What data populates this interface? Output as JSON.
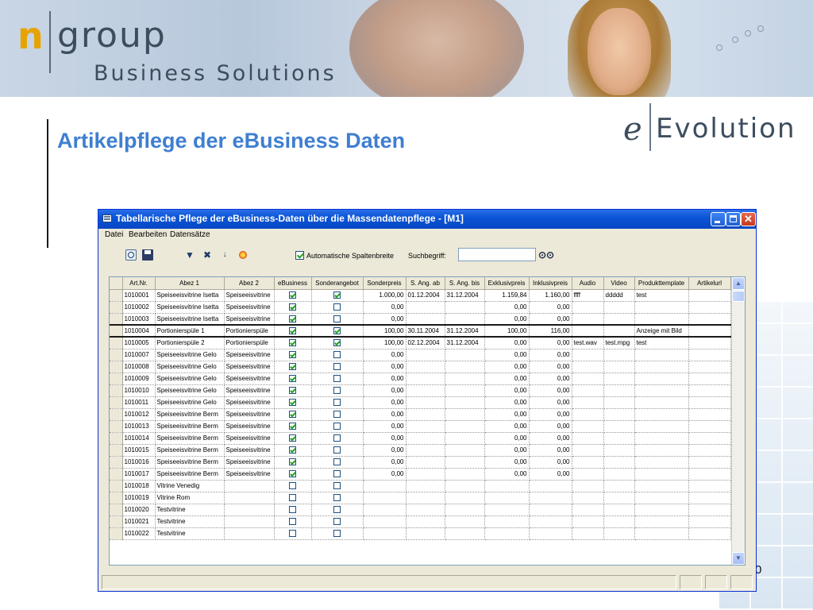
{
  "banner": {
    "logo_n": "n",
    "logo_group": "group",
    "logo_subtitle": "Business Solutions"
  },
  "slide": {
    "title": "Artikelpflege der eBusiness Daten",
    "evo_logo_e": "e",
    "evo_logo_word": "Evolution",
    "page_number": "0"
  },
  "window": {
    "title": "Tabellarische Pflege der eBusiness-Daten über die Massendatenpflege - [M1]",
    "menu": [
      "Datei",
      "Bearbeiten",
      "Datensätze"
    ],
    "toolbar": {
      "auto_width_label": "Automatische Spaltenbreite",
      "auto_width_checked": true,
      "search_label": "Suchbegriff:",
      "search_value": "",
      "icons": [
        "preview-icon",
        "save-icon",
        "filter-icon",
        "remove-filter-icon",
        "sort-icon",
        "color-icon",
        "binoculars-icon"
      ]
    },
    "columns": [
      "Art.Nr.",
      "Abez 1",
      "Abez 2",
      "eBusiness",
      "Sonderangebot",
      "Sonderpreis",
      "S. Ang. ab",
      "S. Ang. bis",
      "Exklusivpreis",
      "Inklusivpreis",
      "Audio",
      "Video",
      "Produkttemplate",
      "Artikelurl"
    ],
    "rows": [
      {
        "artnr": "1010001",
        "abez1": "Speiseeisvitrine Isetta",
        "abez2": "Speiseeisvitrine",
        "ebusiness": true,
        "sonder": true,
        "sonderpreis": "1.000,00",
        "ab": "01.12.2004",
        "bis": "31.12.2004",
        "exkl": "1.159,84",
        "inkl": "1.160,00",
        "audio": "ffff",
        "video": "ddddd",
        "template": "test",
        "url": ""
      },
      {
        "artnr": "1010002",
        "abez1": "Speiseeisvitrine Isetta",
        "abez2": "Speiseeisvitrine",
        "ebusiness": true,
        "sonder": false,
        "sonderpreis": "0,00",
        "ab": "",
        "bis": "",
        "exkl": "0,00",
        "inkl": "0,00",
        "audio": "",
        "video": "",
        "template": "",
        "url": ""
      },
      {
        "artnr": "1010003",
        "abez1": "Speiseeisvitrine Isetta",
        "abez2": "Speiseeisvitrine",
        "ebusiness": true,
        "sonder": false,
        "sonderpreis": "0,00",
        "ab": "",
        "bis": "",
        "exkl": "0,00",
        "inkl": "0,00",
        "audio": "",
        "video": "",
        "template": "",
        "url": ""
      },
      {
        "artnr": "1010004",
        "abez1": "Portionierspüle 1",
        "abez2": "Portionierspüle",
        "ebusiness": true,
        "sonder": true,
        "sonderpreis": "100,00",
        "ab": "30.11.2004",
        "bis": "31.12.2004",
        "exkl": "100,00",
        "inkl": "116,00",
        "audio": "",
        "video": "",
        "template": "Anzeige mit Bild",
        "url": "",
        "current": true
      },
      {
        "artnr": "1010005",
        "abez1": "Portionierspüle 2",
        "abez2": "Portionierspüle",
        "ebusiness": true,
        "sonder": true,
        "sonderpreis": "100,00",
        "ab": "02.12.2004",
        "bis": "31.12.2004",
        "exkl": "0,00",
        "inkl": "0,00",
        "audio": "test.wav",
        "video": "test.mpg",
        "template": "test",
        "url": ""
      },
      {
        "artnr": "1010007",
        "abez1": "Speiseeisvitrine Gelo",
        "abez2": "Speiseeisvitrine",
        "ebusiness": true,
        "sonder": false,
        "sonderpreis": "0,00",
        "ab": "",
        "bis": "",
        "exkl": "0,00",
        "inkl": "0,00",
        "audio": "",
        "video": "",
        "template": "",
        "url": ""
      },
      {
        "artnr": "1010008",
        "abez1": "Speiseeisvitrine Gelo",
        "abez2": "Speiseeisvitrine",
        "ebusiness": true,
        "sonder": false,
        "sonderpreis": "0,00",
        "ab": "",
        "bis": "",
        "exkl": "0,00",
        "inkl": "0,00",
        "audio": "",
        "video": "",
        "template": "",
        "url": ""
      },
      {
        "artnr": "1010009",
        "abez1": "Speiseeisvitrine Gelo",
        "abez2": "Speiseeisvitrine",
        "ebusiness": true,
        "sonder": false,
        "sonderpreis": "0,00",
        "ab": "",
        "bis": "",
        "exkl": "0,00",
        "inkl": "0,00",
        "audio": "",
        "video": "",
        "template": "",
        "url": ""
      },
      {
        "artnr": "1010010",
        "abez1": "Speiseeisvitrine Gelo",
        "abez2": "Speiseeisvitrine",
        "ebusiness": true,
        "sonder": false,
        "sonderpreis": "0,00",
        "ab": "",
        "bis": "",
        "exkl": "0,00",
        "inkl": "0,00",
        "audio": "",
        "video": "",
        "template": "",
        "url": ""
      },
      {
        "artnr": "1010011",
        "abez1": "Speiseeisvitrine Gelo",
        "abez2": "Speiseeisvitrine",
        "ebusiness": true,
        "sonder": false,
        "sonderpreis": "0,00",
        "ab": "",
        "bis": "",
        "exkl": "0,00",
        "inkl": "0,00",
        "audio": "",
        "video": "",
        "template": "",
        "url": ""
      },
      {
        "artnr": "1010012",
        "abez1": "Speiseeisvitrine Berm",
        "abez2": "Speiseeisvitrine",
        "ebusiness": true,
        "sonder": false,
        "sonderpreis": "0,00",
        "ab": "",
        "bis": "",
        "exkl": "0,00",
        "inkl": "0,00",
        "audio": "",
        "video": "",
        "template": "",
        "url": ""
      },
      {
        "artnr": "1010013",
        "abez1": "Speiseeisvitrine Berm",
        "abez2": "Speiseeisvitrine",
        "ebusiness": true,
        "sonder": false,
        "sonderpreis": "0,00",
        "ab": "",
        "bis": "",
        "exkl": "0,00",
        "inkl": "0,00",
        "audio": "",
        "video": "",
        "template": "",
        "url": ""
      },
      {
        "artnr": "1010014",
        "abez1": "Speiseeisvitrine Berm",
        "abez2": "Speiseeisvitrine",
        "ebusiness": true,
        "sonder": false,
        "sonderpreis": "0,00",
        "ab": "",
        "bis": "",
        "exkl": "0,00",
        "inkl": "0,00",
        "audio": "",
        "video": "",
        "template": "",
        "url": ""
      },
      {
        "artnr": "1010015",
        "abez1": "Speiseeisvitrine Berm",
        "abez2": "Speiseeisvitrine",
        "ebusiness": true,
        "sonder": false,
        "sonderpreis": "0,00",
        "ab": "",
        "bis": "",
        "exkl": "0,00",
        "inkl": "0,00",
        "audio": "",
        "video": "",
        "template": "",
        "url": ""
      },
      {
        "artnr": "1010016",
        "abez1": "Speiseeisvitrine Berm",
        "abez2": "Speiseeisvitrine",
        "ebusiness": true,
        "sonder": false,
        "sonderpreis": "0,00",
        "ab": "",
        "bis": "",
        "exkl": "0,00",
        "inkl": "0,00",
        "audio": "",
        "video": "",
        "template": "",
        "url": ""
      },
      {
        "artnr": "1010017",
        "abez1": "Speiseeisvitrine Berm",
        "abez2": "Speiseeisvitrine",
        "ebusiness": true,
        "sonder": false,
        "sonderpreis": "0,00",
        "ab": "",
        "bis": "",
        "exkl": "0,00",
        "inkl": "0,00",
        "audio": "",
        "video": "",
        "template": "",
        "url": ""
      },
      {
        "artnr": "1010018",
        "abez1": "Vitrine Venedig",
        "abez2": "",
        "ebusiness": false,
        "sonder": false,
        "sonderpreis": "",
        "ab": "",
        "bis": "",
        "exkl": "",
        "inkl": "",
        "audio": "",
        "video": "",
        "template": "",
        "url": ""
      },
      {
        "artnr": "1010019",
        "abez1": "Vitrine Rom",
        "abez2": "",
        "ebusiness": false,
        "sonder": false,
        "sonderpreis": "",
        "ab": "",
        "bis": "",
        "exkl": "",
        "inkl": "",
        "audio": "",
        "video": "",
        "template": "",
        "url": ""
      },
      {
        "artnr": "1010020",
        "abez1": "Testvitrine",
        "abez2": "",
        "ebusiness": false,
        "sonder": false,
        "sonderpreis": "",
        "ab": "",
        "bis": "",
        "exkl": "",
        "inkl": "",
        "audio": "",
        "video": "",
        "template": "",
        "url": ""
      },
      {
        "artnr": "1010021",
        "abez1": "Testvitrine",
        "abez2": "",
        "ebusiness": false,
        "sonder": false,
        "sonderpreis": "",
        "ab": "",
        "bis": "",
        "exkl": "",
        "inkl": "",
        "audio": "",
        "video": "",
        "template": "",
        "url": ""
      },
      {
        "artnr": "1010022",
        "abez1": "Testvitrine",
        "abez2": "",
        "ebusiness": false,
        "sonder": false,
        "sonderpreis": "",
        "ab": "",
        "bis": "",
        "exkl": "",
        "inkl": "",
        "audio": "",
        "video": "",
        "template": "",
        "url": ""
      }
    ]
  },
  "colors": {
    "title_blue": "#3f7fd0",
    "xp_titlebar": "#0a55d8",
    "check_green": "#21a121",
    "logo_orange": "#e6a300"
  }
}
